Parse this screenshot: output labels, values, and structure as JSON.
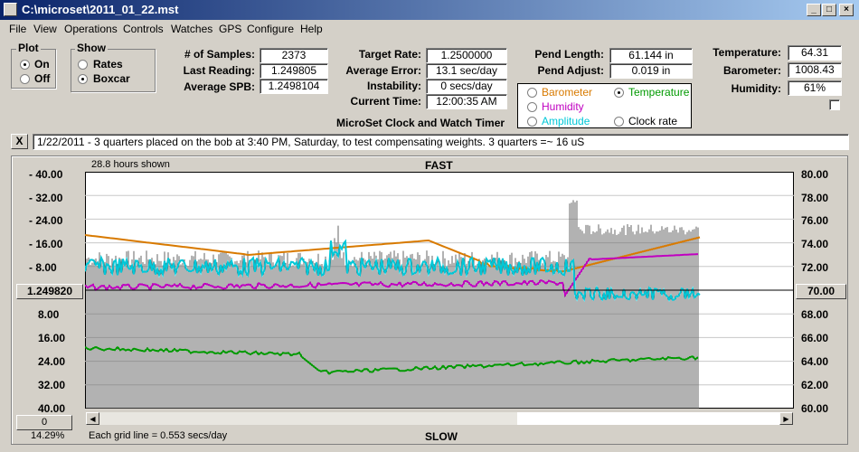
{
  "window": {
    "title": "C:\\microset\\2011_01_22.mst"
  },
  "menu": [
    "File",
    "View",
    "Operations",
    "Controls",
    "Watches",
    "GPS",
    "Configure",
    "Help"
  ],
  "plot_group": {
    "title": "Plot",
    "on": "On",
    "off": "Off",
    "selected": "On"
  },
  "show_group": {
    "title": "Show",
    "rates": "Rates",
    "boxcar": "Boxcar",
    "selected": "Boxcar"
  },
  "stats": {
    "samples_label": "# of Samples:",
    "samples": "2373",
    "last_label": "Last Reading:",
    "last": "1.249805",
    "spb_label": "Average SPB:",
    "spb": "1.2498104"
  },
  "rates": {
    "target_label": "Target Rate:",
    "target": "1.2500000",
    "error_label": "Average Error:",
    "error": "13.1 sec/day",
    "instab_label": "Instability:",
    "instab": "0 secs/day",
    "time_label": "Current Time:",
    "time": "12:00:35 AM"
  },
  "pend": {
    "length_label": "Pend Length:",
    "length": "61.144 in",
    "adjust_label": "Pend Adjust:",
    "adjust": "0.019 in"
  },
  "env": {
    "temp_label": "Temperature:",
    "temp": "64.31",
    "baro_label": "Barometer:",
    "baro": "1008.43",
    "hum_label": "Humidity:",
    "hum": "61%"
  },
  "series_select": {
    "barometer": "Barometer",
    "temperature": "Temperature",
    "humidity": "Humidity",
    "amplitude": "Amplitude",
    "clock_rate": "Clock rate",
    "selected": "Temperature",
    "colors": {
      "barometer": "#d87a00",
      "temperature": "#009a00",
      "humidity": "#c000c0",
      "amplitude": "#00c8d8"
    }
  },
  "app_title": "MicroSet Clock and Watch Timer",
  "note": "1/22/2011 - 3 quarters placed on the bob at 3:40 PM, Saturday, to test compensating weights. 3 quarters =~ 16 uS",
  "note_close": "X",
  "graph": {
    "hours_shown": "28.8 hours shown",
    "top_label": "FAST",
    "bottom_label": "SLOW",
    "left_axis_top": [
      "40.00",
      "32.00",
      "24.00",
      "16.00",
      "8.00"
    ],
    "left_center_value": "1.249820",
    "left_axis_bottom": [
      "8.00",
      "16.00",
      "24.00",
      "32.00",
      "40.00"
    ],
    "right_axis": [
      "80.00",
      "78.00",
      "76.00",
      "74.00",
      "72.00"
    ],
    "right_center_value": "70.00",
    "right_axis_bottom": [
      "68.00",
      "66.00",
      "64.00",
      "62.00",
      "60.00"
    ],
    "grid_info": "Each grid line = 0.553 secs/day",
    "spin_value": "0",
    "percent": "14.29%"
  }
}
